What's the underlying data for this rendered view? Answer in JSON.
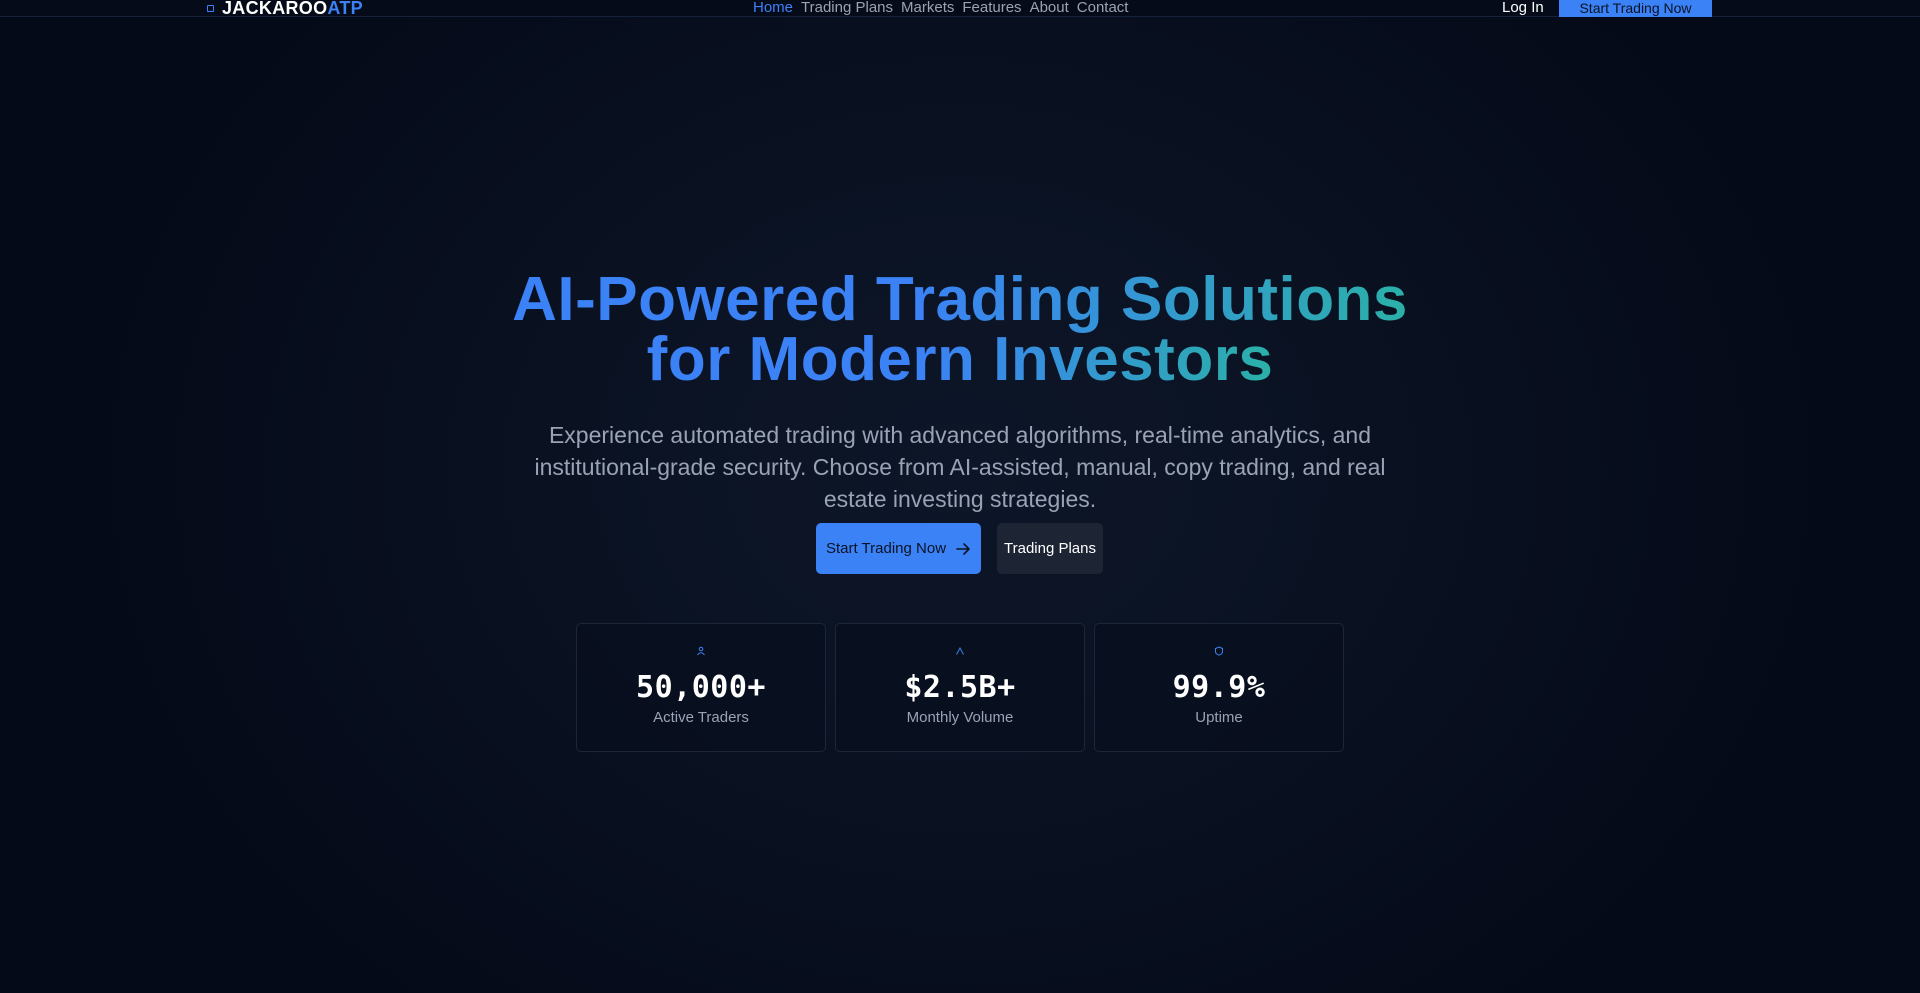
{
  "nav": {
    "logo_primary": "JACKAROO",
    "logo_accent": "ATP",
    "links": [
      {
        "label": "Home",
        "active": true
      },
      {
        "label": "Trading Plans",
        "active": false
      },
      {
        "label": "Markets",
        "active": false
      },
      {
        "label": "Features",
        "active": false
      },
      {
        "label": "About",
        "active": false
      },
      {
        "label": "Contact",
        "active": false
      }
    ],
    "login_label": "Log In",
    "cta_label": "Start Trading Now"
  },
  "hero": {
    "title_line1": "AI-Powered Trading Solutions",
    "title_line2": "for Modern Investors",
    "subtitle": "Experience automated trading with advanced algorithms, real-time analytics, and institutional-grade security. Choose from AI-assisted, manual, copy trading, and real estate investing strategies.",
    "primary_button": "Start Trading Now",
    "secondary_button": "Trading Plans"
  },
  "stats": [
    {
      "value": "50,000+",
      "label": "Active Traders",
      "icon": "users-icon"
    },
    {
      "value": "$2.5B+",
      "label": "Monthly Volume",
      "icon": "chart-up-icon"
    },
    {
      "value": "99.9%",
      "label": "Uptime",
      "icon": "shield-icon"
    }
  ],
  "colors": {
    "accent": "#3b82f6",
    "gradient_end": "#2bb0a8",
    "background": "#050b19"
  }
}
